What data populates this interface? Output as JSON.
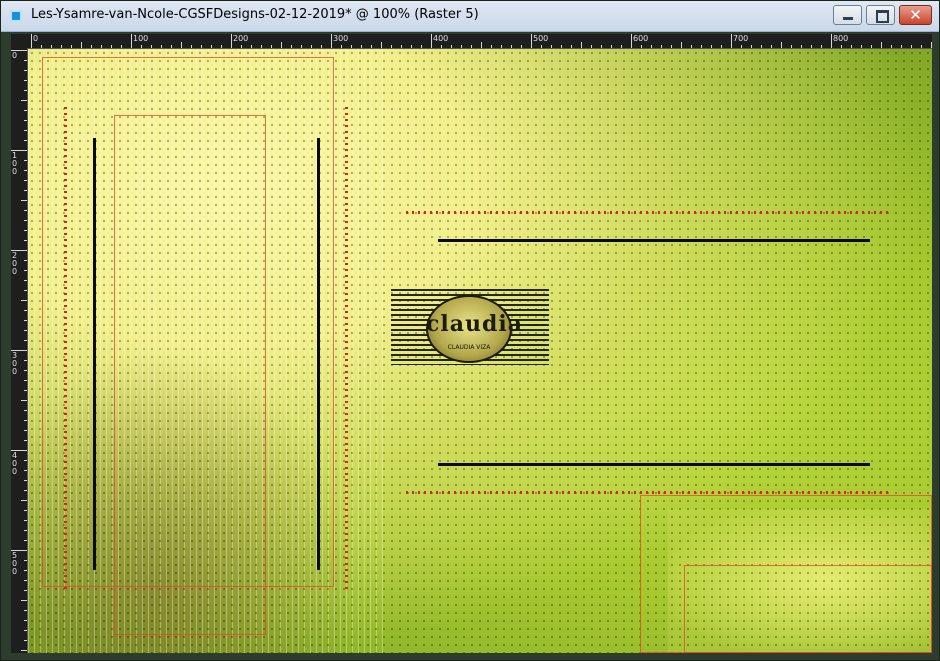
{
  "window": {
    "title": "Les-Ysamre-van-Ncole-CGSFDesigns-02-12-2019* @ 100% (Raster 5)",
    "app_icon": "app-icon",
    "controls": {
      "minimize_icon": "minimize-icon",
      "maximize_icon": "maximize-icon",
      "close_icon": "close-icon",
      "close_glyph": "✕"
    }
  },
  "ruler": {
    "top_labels": [
      "0",
      "100",
      "200",
      "300",
      "400",
      "500",
      "600",
      "700",
      "800"
    ],
    "left_labels": [
      "0",
      "100",
      "200",
      "300",
      "400",
      "500"
    ]
  },
  "canvas": {
    "logo_text": "claudia",
    "logo_subtext": "CLAUDIA VIZA",
    "colors": {
      "accent_red": "#d2271b",
      "lines_black": "#0a0a0a",
      "lime": "#a7c92f",
      "pale_yellow": "#fbf7a6"
    }
  }
}
